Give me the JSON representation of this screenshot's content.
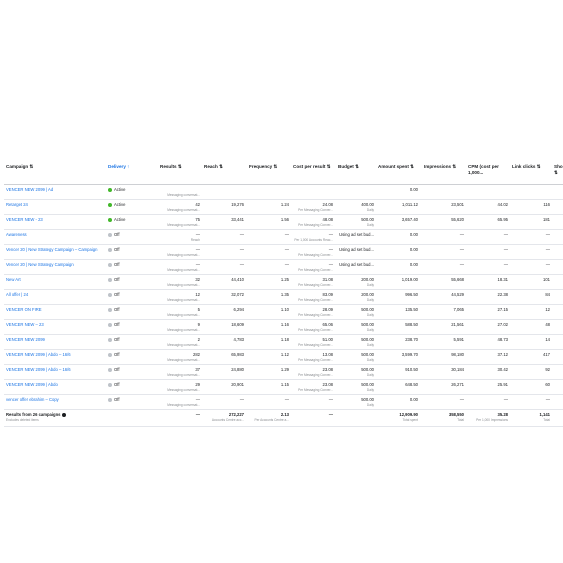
{
  "columns": [
    "Campaign ⇅",
    "Delivery ↑",
    "Results ⇅",
    "Reach ⇅",
    "Frequency ⇅",
    "Cost per result ⇅",
    "Budget ⇅",
    "Amount spent ⇅",
    "Impressions ⇅",
    "CPM (cost per 1,000...",
    "Link clicks ⇅",
    "Sho ⇅"
  ],
  "rows": [
    {
      "campaign": "VENCER NEW 2099 | Ad",
      "delivery": "Active",
      "results": "",
      "results_sub": "Messaging conversat...",
      "reach": "",
      "frequency": "",
      "cpr": "",
      "cpr_sub": "",
      "budget": "",
      "budget_sub": "",
      "spent": "0.00",
      "impr": "",
      "cpm": "",
      "clicks": "",
      "sho": ""
    },
    {
      "campaign": "Retarget 24",
      "delivery": "Active",
      "results": "42",
      "results_sub": "Messaging conversat...",
      "reach": "19,276",
      "frequency": "1.24",
      "cpr": "24.08",
      "cpr_sub": "Per Messaging Conver...",
      "budget": "400.00",
      "budget_sub": "Daily",
      "spent": "1,011.12",
      "impr": "23,501",
      "cpm": "44.02",
      "clicks": "116",
      "sho": ""
    },
    {
      "campaign": "VENCER NEW - 23",
      "delivery": "Active",
      "results": "75",
      "results_sub": "Messaging conversat...",
      "reach": "33,441",
      "frequency": "1.56",
      "cpr": "48.08",
      "cpr_sub": "Per Messaging Conver...",
      "budget": "500.00",
      "budget_sub": "Daily",
      "spent": "3,657.40",
      "impr": "55,620",
      "cpm": "65.95",
      "clicks": "181",
      "sho": ""
    },
    {
      "campaign": "Awareness",
      "delivery": "Off",
      "results": "—",
      "results_sub": "Reach",
      "reach": "—",
      "frequency": "—",
      "cpr": "—",
      "cpr_sub": "Per 1,000 Accounts Reac...",
      "budget": "Using ad set bud...",
      "budget_sub": "",
      "spent": "0.00",
      "impr": "—",
      "cpm": "—",
      "clicks": "—",
      "sho": ""
    },
    {
      "campaign": "Vencer 20 | New Strategy Campaign – Campaign",
      "delivery": "Off",
      "results": "—",
      "results_sub": "Messaging conversat...",
      "reach": "—",
      "frequency": "—",
      "cpr": "—",
      "cpr_sub": "Per Messaging Conver...",
      "budget": "Using ad set bud...",
      "budget_sub": "",
      "spent": "0.00",
      "impr": "—",
      "cpm": "—",
      "clicks": "—",
      "sho": ""
    },
    {
      "campaign": "Vencer 20 | New Strategy Campaign",
      "delivery": "Off",
      "results": "—",
      "results_sub": "Messaging conversat...",
      "reach": "—",
      "frequency": "—",
      "cpr": "—",
      "cpr_sub": "Per Messaging Conver...",
      "budget": "Using ad set bud...",
      "budget_sub": "",
      "spent": "0.00",
      "impr": "—",
      "cpm": "—",
      "clicks": "—",
      "sho": ""
    },
    {
      "campaign": "New Art",
      "delivery": "Off",
      "results": "32",
      "results_sub": "Messaging conversat...",
      "reach": "44,410",
      "frequency": "1.25",
      "cpr": "31.08",
      "cpr_sub": "Per Messaging Conver...",
      "budget": "200.00",
      "budget_sub": "Daily",
      "spent": "1,019.00",
      "impr": "55,668",
      "cpm": "18.31",
      "clicks": "101",
      "sho": ""
    },
    {
      "campaign": "All offer | 24",
      "delivery": "Off",
      "results": "12",
      "results_sub": "Messaging conversat...",
      "reach": "32,072",
      "frequency": "1.35",
      "cpr": "83.09",
      "cpr_sub": "Per Messaging Conver...",
      "budget": "200.00",
      "budget_sub": "Daily",
      "spent": "996.50",
      "impr": "44,529",
      "cpm": "22.38",
      "clicks": "84",
      "sho": ""
    },
    {
      "campaign": "VENCER ON FIRE",
      "delivery": "Off",
      "results": "5",
      "results_sub": "Messaging conversat...",
      "reach": "6,294",
      "frequency": "1.10",
      "cpr": "28.09",
      "cpr_sub": "Per Messaging Conver...",
      "budget": "500.00",
      "budget_sub": "Daily",
      "spent": "135.50",
      "impr": "7,065",
      "cpm": "27.15",
      "clicks": "12",
      "sho": ""
    },
    {
      "campaign": "VENCER NEW – 23",
      "delivery": "Off",
      "results": "9",
      "results_sub": "Messaging conversat...",
      "reach": "18,609",
      "frequency": "1.16",
      "cpr": "65.06",
      "cpr_sub": "Per Messaging Conver...",
      "budget": "500.00",
      "budget_sub": "Daily",
      "spent": "588.50",
      "impr": "21,561",
      "cpm": "27.02",
      "clicks": "48",
      "sho": ""
    },
    {
      "campaign": "VENCER NEW 2099",
      "delivery": "Off",
      "results": "2",
      "results_sub": "Messaging conversat...",
      "reach": "4,783",
      "frequency": "1.18",
      "cpr": "51.00",
      "cpr_sub": "Per Messaging Conver...",
      "budget": "500.00",
      "budget_sub": "Daily",
      "spent": "238.70",
      "impr": "5,591",
      "cpm": "48.73",
      "clicks": "14",
      "sho": ""
    },
    {
      "campaign": "VENCER NEW 2099 | Abdo – 16/6",
      "delivery": "Off",
      "results": "282",
      "results_sub": "Messaging conversat...",
      "reach": "65,983",
      "frequency": "1.12",
      "cpr": "13.08",
      "cpr_sub": "Per Messaging Conver...",
      "budget": "500.00",
      "budget_sub": "Daily",
      "spent": "3,599.70",
      "impr": "98,180",
      "cpm": "37.12",
      "clicks": "417",
      "sho": ""
    },
    {
      "campaign": "VENCER NEW 2099 | Abdo – 16/6",
      "delivery": "Off",
      "results": "37",
      "results_sub": "Messaging conversat...",
      "reach": "24,880",
      "frequency": "1.29",
      "cpr": "23.08",
      "cpr_sub": "Per Messaging Conver...",
      "budget": "500.00",
      "budget_sub": "Daily",
      "spent": "910.50",
      "impr": "30,184",
      "cpm": "30.42",
      "clicks": "92",
      "sho": ""
    },
    {
      "campaign": "VENCER NEW 2099 | Abdo",
      "delivery": "Off",
      "results": "29",
      "results_sub": "Messaging conversat...",
      "reach": "20,901",
      "frequency": "1.15",
      "cpr": "23.08",
      "cpr_sub": "Per Messaging Conver...",
      "budget": "500.00",
      "budget_sub": "Daily",
      "spent": "648.50",
      "impr": "26,271",
      "cpm": "25.91",
      "clicks": "60",
      "sho": ""
    },
    {
      "campaign": "vencer offer ebrahim – Copy",
      "delivery": "Off",
      "results": "—",
      "results_sub": "Messaging conversat...",
      "reach": "—",
      "frequency": "—",
      "cpr": "—",
      "cpr_sub": "",
      "budget": "500.00",
      "budget_sub": "Daily",
      "spent": "0.00",
      "impr": "—",
      "cpm": "—",
      "clicks": "—",
      "sho": ""
    }
  ],
  "footer": {
    "campaign": "Results from 26 campaigns",
    "campaign_sub": "Excludes deleted items",
    "results": "—",
    "reach": "272,227",
    "reach_sub": "Accounts Centre acc...",
    "frequency": "2.13",
    "frequency_sub": "Per Accounts Centre a...",
    "cpr": "—",
    "budget": "",
    "spent": "12,909.90",
    "spent_sub": "Total spent",
    "impr": "358,550",
    "impr_sub": "Total",
    "cpm": "35.28",
    "cpm_sub": "Per 1,000 Impressions",
    "clicks": "1,141",
    "clicks_sub": "Total"
  },
  "colors": {
    "active": "#42b72a",
    "off": "#bec3c9",
    "link": "#1b74e4"
  }
}
